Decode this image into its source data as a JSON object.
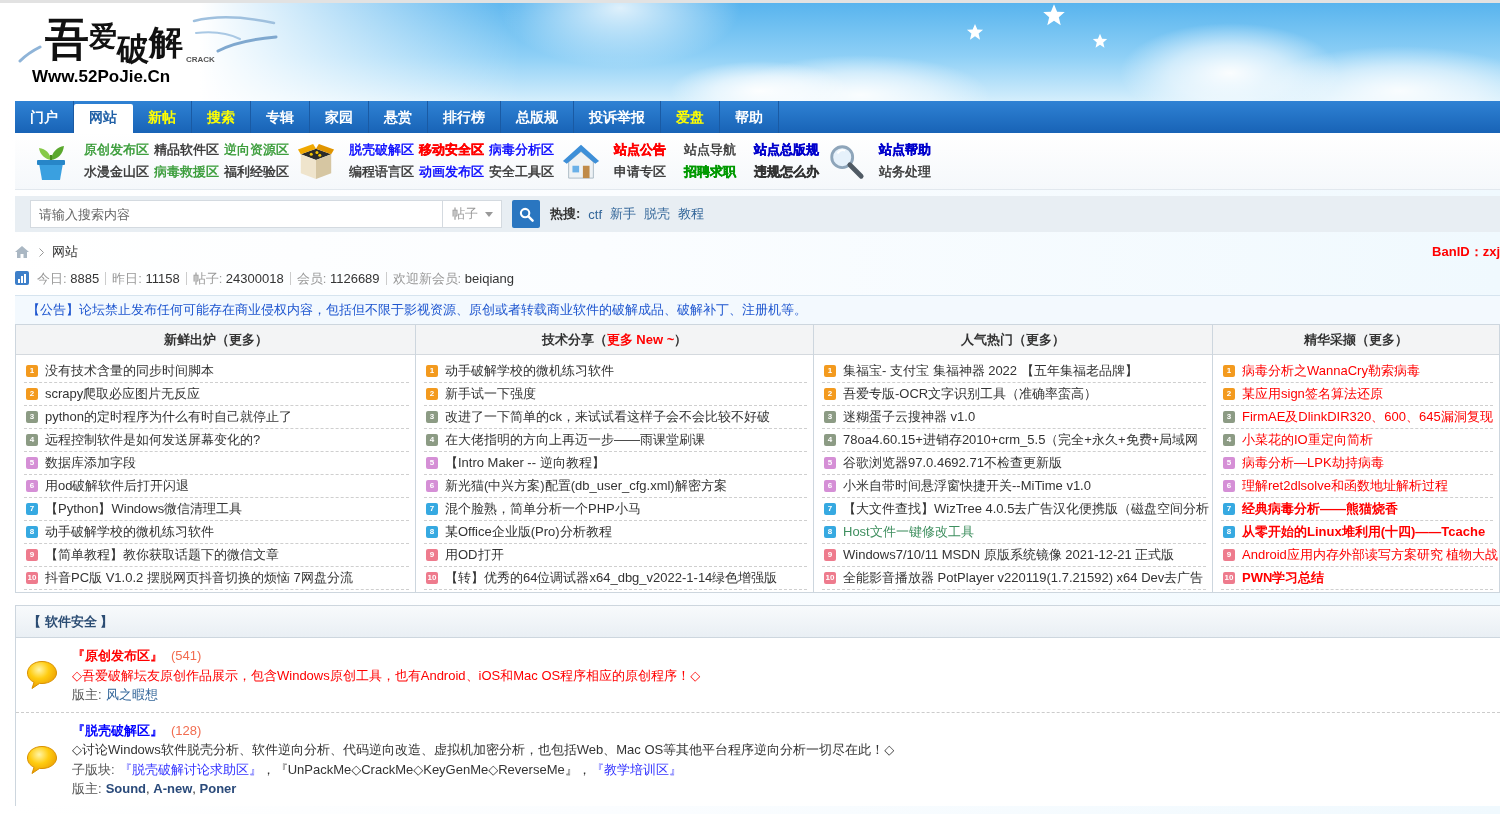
{
  "header": {
    "logo": {
      "title": "吾爱破解",
      "badge": "CRACK",
      "url": "Www.52PoJie.Cn"
    }
  },
  "nav": {
    "items": [
      {
        "label": "门户",
        "selected": false,
        "highlighted": false
      },
      {
        "label": "网站",
        "selected": true,
        "highlighted": false
      },
      {
        "label": "新帖",
        "selected": false,
        "highlighted": true
      },
      {
        "label": "搜索",
        "selected": false,
        "highlighted": true
      },
      {
        "label": "专辑",
        "selected": false,
        "highlighted": false
      },
      {
        "label": "家园",
        "selected": false,
        "highlighted": false
      },
      {
        "label": "悬赏",
        "selected": false,
        "highlighted": false
      },
      {
        "label": "排行榜",
        "selected": false,
        "highlighted": false
      },
      {
        "label": "总版规",
        "selected": false,
        "highlighted": false
      },
      {
        "label": "投诉举报",
        "selected": false,
        "highlighted": false
      },
      {
        "label": "爱盘",
        "selected": false,
        "highlighted": true
      },
      {
        "label": "帮助",
        "selected": false,
        "highlighted": false
      }
    ]
  },
  "quick_links": {
    "groups": [
      {
        "rows": [
          [
            {
              "label": "原创发布区",
              "color": "#339933",
              "bold": false
            },
            {
              "label": "精品软件区",
              "color": "#333333",
              "bold": false
            },
            {
              "label": "逆向资源区",
              "color": "#339933",
              "bold": false
            }
          ],
          [
            {
              "label": "水漫金山区",
              "color": "#333333",
              "bold": false
            },
            {
              "label": "病毒救援区",
              "color": "#339933",
              "bold": false
            },
            {
              "label": "福利经验区",
              "color": "#333333",
              "bold": false
            }
          ]
        ]
      },
      {
        "rows": [
          [
            {
              "label": "脱壳破解区",
              "color": "#0000ff",
              "bold": false
            },
            {
              "label": "移动安全区",
              "color": "#ff0000",
              "bold": true
            },
            {
              "label": "病毒分析区",
              "color": "#0000ff",
              "bold": false
            }
          ],
          [
            {
              "label": "编程语言区",
              "color": "#333333",
              "bold": false
            },
            {
              "label": "动画发布区",
              "color": "#0000ff",
              "bold": false
            },
            {
              "label": "安全工具区",
              "color": "#333333",
              "bold": false
            }
          ]
        ]
      },
      {
        "rows": [
          [
            {
              "label": "站点公告",
              "color": "#ff0000",
              "bold": true
            },
            {
              "label": "站点导航",
              "color": "#333333",
              "bold": false
            },
            {
              "label": "站点总版规",
              "color": "#0000cc",
              "bold": true
            }
          ],
          [
            {
              "label": "申请专区",
              "color": "#333333",
              "bold": false
            },
            {
              "label": "招聘求职",
              "color": "#009900",
              "bold": true
            },
            {
              "label": "违规怎么办",
              "color": "#333333",
              "bold": true
            }
          ]
        ]
      },
      {
        "rows": [
          [
            {
              "label": "站点帮助",
              "color": "#0000cc",
              "bold": true
            }
          ],
          [
            {
              "label": "站务处理",
              "color": "#333333",
              "bold": false
            }
          ]
        ]
      }
    ]
  },
  "search": {
    "placeholder": "请输入搜索内容",
    "scope": "帖子",
    "hot_label": "热搜:",
    "hot": [
      "ctf",
      "新手",
      "脱壳",
      "教程"
    ]
  },
  "breadcrumb": {
    "items": [
      "网站"
    ]
  },
  "ban_id": "BanID：zxj",
  "stats": [
    {
      "label": "今日:",
      "value": "8885"
    },
    {
      "label": "昨日:",
      "value": "11158"
    },
    {
      "label": "帖子:",
      "value": "24300018"
    },
    {
      "label": "会员:",
      "value": "1126689"
    },
    {
      "label": "欢迎新会员:",
      "value": "beiqiang"
    }
  ],
  "announcement": "【公告】论坛禁止发布任何可能存在商业侵权内容，包括但不限于影视资源、原创或者转载商业软件的破解成品、破解补丁、注册机等。",
  "topic_columns": [
    {
      "title_before": "新鲜出炉（",
      "link": {
        "label": "更多",
        "color": "#333333"
      },
      "title_after": "）",
      "items": [
        {
          "rank": "1",
          "text": "没有技术含量的同步时间脚本"
        },
        {
          "rank": "2",
          "text": "scrapy爬取必应图片无反应"
        },
        {
          "rank": "3",
          "text": "python的定时程序为什么有时自己就停止了"
        },
        {
          "rank": "4",
          "text": "远程控制软件是如何发送屏幕变化的?"
        },
        {
          "rank": "5",
          "text": "数据库添加字段"
        },
        {
          "rank": "6",
          "text": "用od破解软件后打开闪退"
        },
        {
          "rank": "7",
          "text": "【Python】Windows微信清理工具"
        },
        {
          "rank": "8",
          "text": "动手破解学校的微机练习软件"
        },
        {
          "rank": "9",
          "text": "【简单教程】教你获取话题下的微信文章"
        },
        {
          "rank": "10",
          "text": "抖音PC版 V1.0.2 摆脱网页抖音切换的烦恼 7网盘分流"
        }
      ]
    },
    {
      "title_before": "技术分享（",
      "link": {
        "label": "更多 New ~",
        "color": "#ff0000"
      },
      "title_after": "）",
      "items": [
        {
          "rank": "1",
          "text": "动手破解学校的微机练习软件"
        },
        {
          "rank": "2",
          "text": "新手试一下强度"
        },
        {
          "rank": "3",
          "text": "改进了一下简单的ck，来试试看这样子会不会比较不好破"
        },
        {
          "rank": "4",
          "text": "在大佬指明的方向上再迈一步——雨课堂刷课"
        },
        {
          "rank": "5",
          "text": "【Intro Maker -- 逆向教程】"
        },
        {
          "rank": "6",
          "text": "新光猫(中兴方案)配置(db_user_cfg.xml)解密方案"
        },
        {
          "rank": "7",
          "text": "混个脸熟，简单分析一个PHP小马"
        },
        {
          "rank": "8",
          "text": "某Office企业版(Pro)分析教程"
        },
        {
          "rank": "9",
          "text": "用OD打开"
        },
        {
          "rank": "10",
          "text": "【转】优秀的64位调试器x64_dbg_v2022-1-14绿色增强版"
        }
      ]
    },
    {
      "title_before": "人气热门（",
      "link": {
        "label": "更多",
        "color": "#333333"
      },
      "title_after": "）",
      "items": [
        {
          "rank": "1",
          "text": "集福宝- 支付宝 集福神器 2022 【五年集福老品牌】",
          "color": "#333333"
        },
        {
          "rank": "2",
          "text": "吾爱专版-OCR文字识别工具（准确率蛮高）",
          "color": "#333333"
        },
        {
          "rank": "3",
          "text": "迷糊蛋子云搜神器 v1.0",
          "color": "#333333"
        },
        {
          "rank": "4",
          "text": "78oa4.60.15+进销存2010+crm_5.5（完全+永久+免费+局域网",
          "color": "#333333"
        },
        {
          "rank": "5",
          "text": "谷歌浏览器97.0.4692.71不检查更新版",
          "color": "#333333"
        },
        {
          "rank": "6",
          "text": "小米自带时间悬浮窗快捷开关--MiTime v1.0",
          "color": "#333333"
        },
        {
          "rank": "7",
          "text": "【大文件查找】WizTree 4.0.5去广告汉化便携版（磁盘空间分析",
          "color": "#333333"
        },
        {
          "rank": "8",
          "text": "Host文件一键修改工具",
          "color": "#3f8f5f"
        },
        {
          "rank": "9",
          "text": "Windows7/10/11 MSDN 原版系统镜像 2021-12-21 正式版",
          "color": "#333333"
        },
        {
          "rank": "10",
          "text": "全能影音播放器 PotPlayer v220119(1.7.21592) x64 Dev去广告",
          "color": "#333333"
        }
      ]
    },
    {
      "title_before": "精华采撷（",
      "link": {
        "label": "更多",
        "color": "#333333"
      },
      "title_after": "）",
      "items": [
        {
          "rank": "1",
          "text": "病毒分析之WannaCry勒索病毒",
          "color": "#ff0000",
          "bold": false
        },
        {
          "rank": "2",
          "text": "某应用sign签名算法还原",
          "color": "#ff0000",
          "bold": false
        },
        {
          "rank": "3",
          "text": "FirmAE及DlinkDIR320、600、645漏洞复现",
          "color": "#ff0000",
          "bold": false
        },
        {
          "rank": "4",
          "text": "小菜花的IO重定向简析",
          "color": "#ff0000",
          "bold": false
        },
        {
          "rank": "5",
          "text": "病毒分析—LPK劫持病毒",
          "color": "#ff0000",
          "bold": false
        },
        {
          "rank": "6",
          "text": "理解ret2dlsolve和函数地址解析过程",
          "color": "#ff0000",
          "bold": false
        },
        {
          "rank": "7",
          "text": "经典病毒分析——熊猫烧香",
          "color": "#ff0000",
          "bold": true
        },
        {
          "rank": "8",
          "text": "从零开始的Linux堆利用(十四)——Tcache",
          "color": "#ff0000",
          "bold": true
        },
        {
          "rank": "9",
          "text": "Android应用内存外部读写方案研究 植物大战",
          "color": "#ff0000",
          "bold": false
        },
        {
          "rank": "10",
          "text": "PWN学习总结",
          "color": "#ff0000",
          "bold": true
        }
      ]
    }
  ],
  "forum_section": {
    "title": "【 软件安全 】",
    "forums": [
      {
        "name": "『原创发布区』",
        "color": "#ff0000",
        "count": "(541)",
        "description": {
          "text": "◇吾爱破解坛友原创作品展示，包含Windows原创工具，也有Android、iOS和Mac OS程序相应的原创程序！◇",
          "color": "#ff0000"
        },
        "moderators": {
          "label": "版主:",
          "parts": [
            {
              "kind": "link",
              "text": "风之暇想",
              "bold": false
            }
          ]
        }
      },
      {
        "name": "『脱壳破解区』",
        "color": "#0000ff",
        "count": "(128)",
        "description": {
          "text": "◇讨论Windows软件脱壳分析、软件逆向分析、代码逆向改造、虚拟机加密分析，也包括Web、Mac OS等其他平台程序逆向分析一切尽在此！◇",
          "color": "#333333"
        },
        "subforums": {
          "label": "子版块:",
          "parts": [
            {
              "kind": "link",
              "text": "『脱壳破解讨论求助区』",
              "color": "#3333ff"
            },
            {
              "kind": "text",
              "text": "，"
            },
            {
              "kind": "link",
              "text": "『UnPackMe◇CrackMe◇KeyGenMe◇ReverseMe』",
              "color": "#333333"
            },
            {
              "kind": "text",
              "text": "，"
            },
            {
              "kind": "link",
              "text": "『教学培训区』",
              "color": "#3333ff"
            }
          ]
        },
        "moderators": {
          "label": "版主:",
          "parts": [
            {
              "kind": "link",
              "text": "Sound",
              "bold": true
            },
            {
              "kind": "text",
              "text": ", "
            },
            {
              "kind": "link",
              "text": "A-new",
              "bold": true
            },
            {
              "kind": "text",
              "text": ", "
            },
            {
              "kind": "link",
              "text": "Poner",
              "bold": true
            }
          ]
        }
      }
    ]
  }
}
